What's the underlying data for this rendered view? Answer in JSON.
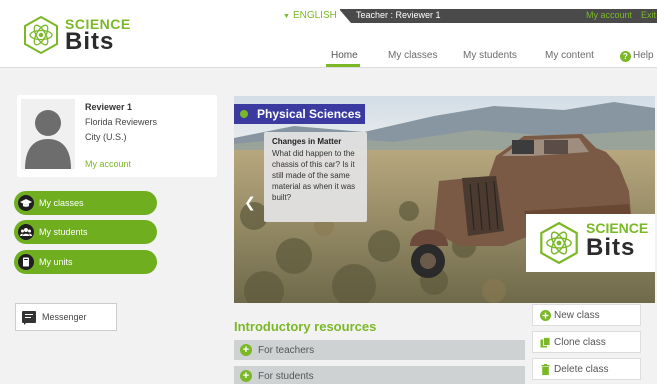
{
  "logo": {
    "science": "SCIENCE",
    "bits": "Bits"
  },
  "language": "ENGLISH",
  "topbar": {
    "teacher": "Teacher : Reviewer 1",
    "my_account": "My account",
    "exit": "Exit"
  },
  "nav": {
    "home": "Home",
    "my_classes": "My classes",
    "my_students": "My students",
    "my_content": "My content",
    "help": "Help"
  },
  "profile": {
    "name": "Reviewer 1",
    "line1": "Florida Reviewers",
    "line2": "City (U.S.)",
    "account_link": "My account"
  },
  "sidebar": {
    "my_classes": "My classes",
    "my_students": "My students",
    "my_units": "My units"
  },
  "messenger": "Messenger",
  "banner": {
    "title": "Physical Sciences",
    "card_title": "Changes in Matter",
    "card_text": "What did happen to the chassis of this car? Is it still made of the same material as when it was built?",
    "logo_science": "SCIENCE",
    "logo_bits": "Bits"
  },
  "intro": {
    "title": "Introductory resources",
    "for_teachers": "For teachers",
    "for_students": "For students"
  },
  "actions": {
    "new_class": "New class",
    "clone_class": "Clone class",
    "delete_class": "Delete class"
  },
  "colors": {
    "accent": "#7bb827",
    "banner_title_bg": "#3a3aa0",
    "topbar": "#4a4a4a"
  }
}
